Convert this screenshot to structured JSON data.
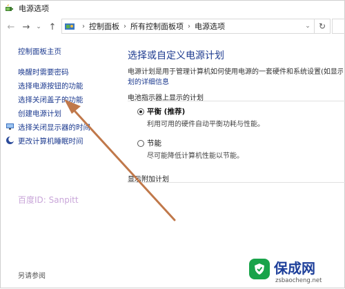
{
  "window": {
    "title": "电源选项"
  },
  "navigation": {
    "breadcrumbs": [
      "控制面板",
      "所有控制面板项",
      "电源选项"
    ]
  },
  "left_pane": {
    "home_link": "控制面板主页",
    "links": [
      "唤醒时需要密码",
      "选择电源按钮的功能",
      "选择关闭盖子的功能",
      "创建电源计划",
      "选择关闭显示器的时间",
      "更改计算机睡眠时间"
    ],
    "see_also": "另请参阅",
    "watermark": "百度ID: Sanpitt"
  },
  "main": {
    "title": "选择或自定义电源计划",
    "description": "电源计划是用于管理计算机如何使用电源的一套硬件和系统设置(如显示",
    "detail_link": "划的详细信息",
    "battery_section": "电池指示器上显示的计划",
    "plans": [
      {
        "name": "平衡 (推荐)",
        "desc": "利用可用的硬件自动平衡功耗与性能。",
        "selected": true
      },
      {
        "name": "节能",
        "desc": "尽可能降低计算机性能以节能。",
        "selected": false
      }
    ],
    "extra_section": "显示附加计划"
  },
  "logo": {
    "text": "保成网",
    "url": "zsbaocheng.net"
  },
  "colors": {
    "link": "#1c3a8f",
    "arrow": "#c0784a",
    "logo_green": "#19a34a",
    "logo_blue": "#1d3f9a"
  }
}
